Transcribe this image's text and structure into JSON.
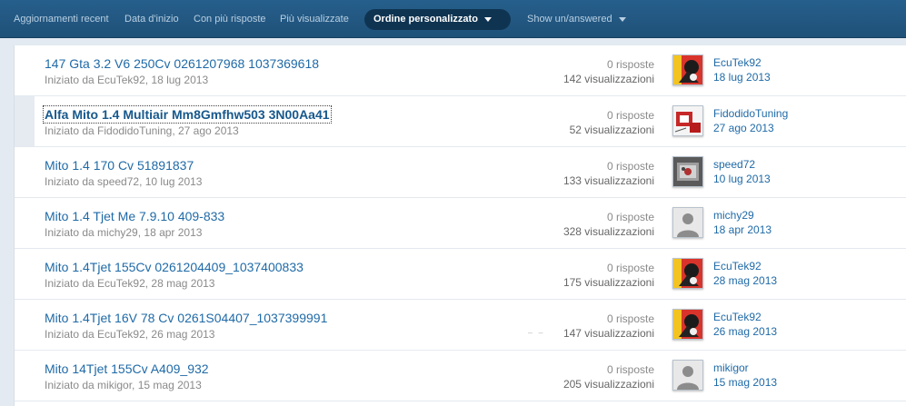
{
  "tabs": [
    {
      "label": "Aggiornamenti recent"
    },
    {
      "label": "Data d'inizio"
    },
    {
      "label": "Con più risposte"
    },
    {
      "label": "Più visualizzate"
    },
    {
      "label": "Ordine personalizzato",
      "active": true,
      "dropdown": true
    },
    {
      "label": "Show un/answered",
      "dropdown": true
    }
  ],
  "topics": [
    {
      "title": "147 Gta 3.2 V6 250Cv 0261207968 1037369618",
      "started": "Iniziato da EcuTek92, 18 lug 2013",
      "replies": "0 risposte",
      "views": "142 visualizzazioni",
      "user": "EcuTek92",
      "date": "18 lug 2013",
      "avatar": "ecutek"
    },
    {
      "title": "Alfa Mito 1.4 Multiair Mm8Gmfhw503 3N00Aa41",
      "started": "Iniziato da FidodidoTuning, 27 ago 2013",
      "replies": "0 risposte",
      "views": "52 visualizzazioni",
      "user": "FidodidoTuning",
      "date": "27 ago 2013",
      "avatar": "fidodido"
    },
    {
      "title": "Mito 1.4 170 Cv 51891837",
      "started": "Iniziato da speed72, 10 lug 2013",
      "replies": "0 risposte",
      "views": "133 visualizzazioni",
      "user": "speed72",
      "date": "10 lug 2013",
      "avatar": "speed"
    },
    {
      "title": "Mito 1.4 Tjet Me 7.9.10 409-833",
      "started": "Iniziato da michy29, 18 apr 2013",
      "replies": "0 risposte",
      "views": "328 visualizzazioni",
      "user": "michy29",
      "date": "18 apr 2013",
      "avatar": "default"
    },
    {
      "title": "Mito 1.4Tjet 155Cv 0261204409_1037400833",
      "started": "Iniziato da EcuTek92, 28 mag 2013",
      "replies": "0 risposte",
      "views": "175 visualizzazioni",
      "user": "EcuTek92",
      "date": "28 mag 2013",
      "avatar": "ecutek"
    },
    {
      "title": "Mito 1.4Tjet 16V 78 Cv 0261S04407_1037399991",
      "started": "Iniziato da EcuTek92, 26 mag 2013",
      "replies": "0 risposte",
      "views": "147 visualizzazioni",
      "user": "EcuTek92",
      "date": "26 mag 2013",
      "avatar": "ecutek"
    },
    {
      "title": "Mito 14Tjet 155Cv A409_932",
      "started": "Iniziato da mikigor, 15 mag 2013",
      "replies": "0 risposte",
      "views": "205 visualizzazioni",
      "user": "mikigor",
      "date": "15 mag 2013",
      "avatar": "default"
    }
  ],
  "colors": {
    "nav": "#1f5178",
    "active_tab": "#0f3452",
    "link": "#1f6aa7",
    "muted": "#8a8a8a"
  }
}
